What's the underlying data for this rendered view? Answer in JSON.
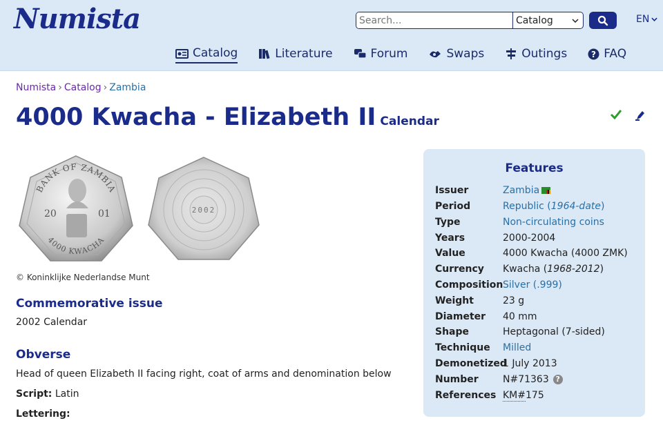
{
  "header": {
    "logo": "Numista",
    "search": {
      "placeholder": "Search...",
      "scope": "Catalog"
    },
    "language": "EN",
    "nav": [
      {
        "label": "Catalog",
        "icon": "catalog-icon"
      },
      {
        "label": "Literature",
        "icon": "books-icon"
      },
      {
        "label": "Forum",
        "icon": "forum-icon"
      },
      {
        "label": "Swaps",
        "icon": "swaps-icon"
      },
      {
        "label": "Outings",
        "icon": "outings-icon"
      },
      {
        "label": "FAQ",
        "icon": "question-icon"
      }
    ]
  },
  "breadcrumb": [
    "Numista",
    "Catalog",
    "Zambia"
  ],
  "page": {
    "title": "4000 Kwacha - Elizabeth II",
    "subtitle": "Calendar"
  },
  "coin": {
    "obverse_text_top": "BANK OF ZAMBIA",
    "obverse_year_left": "20",
    "obverse_year_right": "01",
    "obverse_denomination": "4000 KWACHA",
    "reverse_year": "2002"
  },
  "copyright": "© Koninklijke Nederlandse Munt",
  "sections": {
    "commemorative_heading": "Commemorative issue",
    "commemorative_text": "2002 Calendar",
    "obverse_heading": "Obverse",
    "obverse_text": "Head of queen Elizabeth II facing right, coat of arms and denomination below",
    "script_label": "Script:",
    "script_value": "Latin",
    "lettering_label": "Lettering:"
  },
  "features": {
    "title": "Features",
    "rows": [
      {
        "key": "Issuer",
        "value": "Zambia"
      },
      {
        "key": "Period",
        "value": "Republic (",
        "value_italic": "1964-date",
        "value_end": ")"
      },
      {
        "key": "Type",
        "value": "Non-circulating coins"
      },
      {
        "key": "Years",
        "value": "2000-2004"
      },
      {
        "key": "Value",
        "value": "4000 Kwacha (4000 ZMK)"
      },
      {
        "key": "Currency",
        "value": "Kwacha (",
        "value_italic": "1968-2012",
        "value_end": ")"
      },
      {
        "key": "Composition",
        "value": "Silver (.999)"
      },
      {
        "key": "Weight",
        "value": "23 g"
      },
      {
        "key": "Diameter",
        "value": "40 mm"
      },
      {
        "key": "Shape",
        "value": "Heptagonal (7-sided)"
      },
      {
        "key": "Technique",
        "value": "Milled"
      },
      {
        "key": "Demonetized",
        "value": "1 July 2013"
      },
      {
        "key": "Number",
        "value": "N#71363"
      },
      {
        "key": "References",
        "value": "KM#",
        "value_end": "175"
      }
    ]
  },
  "colors": {
    "brand": "#1b2b8a",
    "header_bg": "#dbe8f5",
    "link": "#2a6fa5",
    "breadcrumb": "#6a28b0"
  }
}
